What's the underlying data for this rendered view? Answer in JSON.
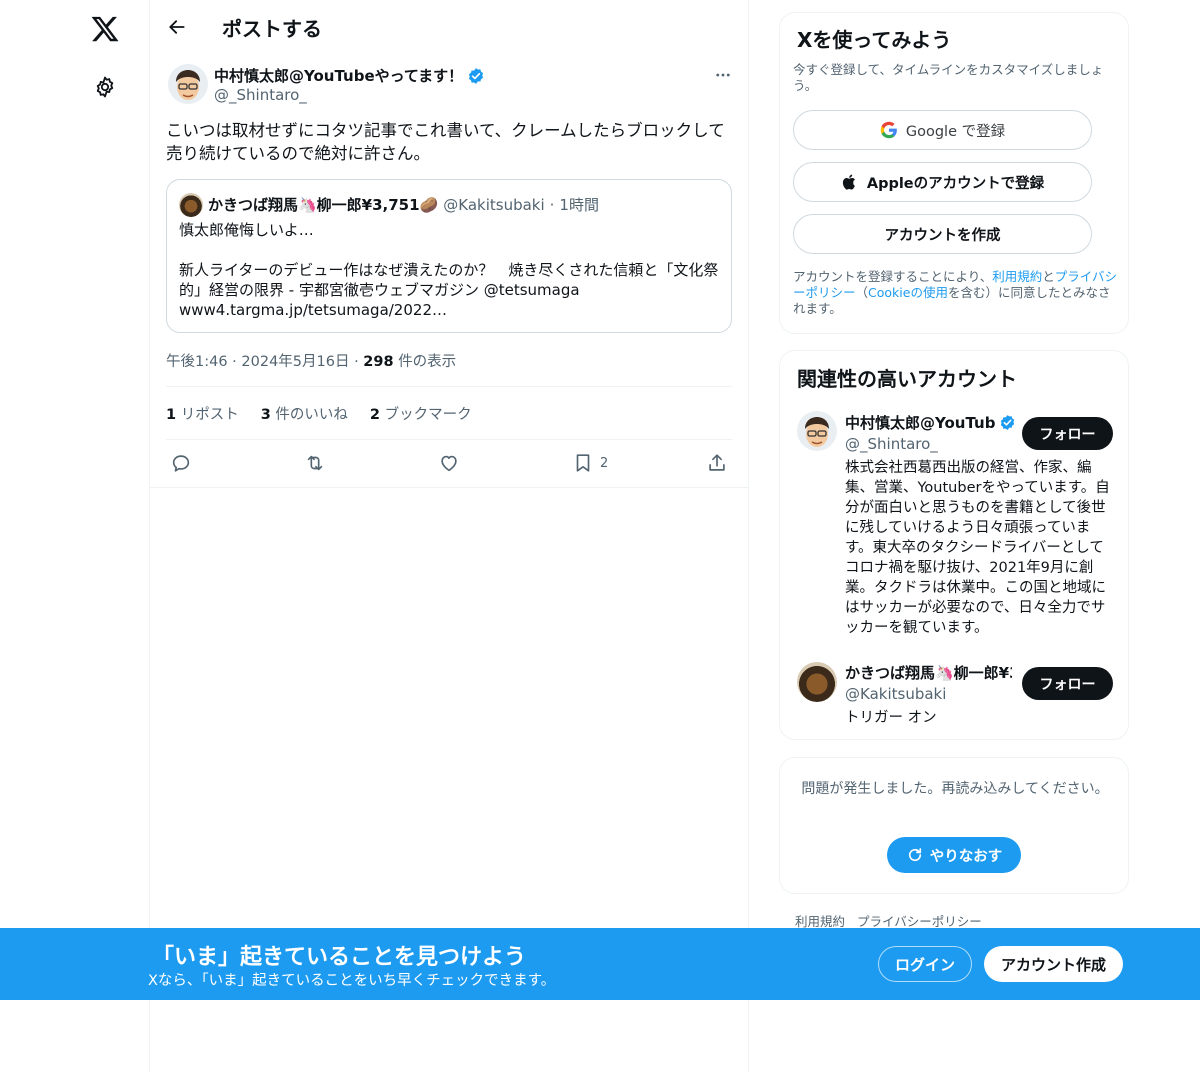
{
  "nav": {
    "logo_icon": "x-logo-icon",
    "settings_icon": "gear-icon"
  },
  "header": {
    "title": "ポストする",
    "back_icon": "arrow-left-icon"
  },
  "tweet": {
    "author_name": "中村慎太郎@YouTubeやってます！",
    "author_handle": "@_Shintaro_",
    "verified": true,
    "text": "こいつは取材せずにコタツ記事でこれ書いて、クレームしたらブロックして売り続けているので絶対に許さん。",
    "quote": {
      "name": "かきつば翔馬🦄柳一郎¥3,751🥔",
      "handle": "@Kakitsubaki",
      "time": "1時間",
      "body": "慎太郎俺悔しいよ…\n\n新人ライターのデビュー作はなぜ潰えたのか？　焼き尽くされた信頼と「文化祭的」経営の限界 - 宇都宮徹壱ウェブマガジン @tetsumaga\nwww4.targma.jp/tetsumaga/2022…"
    },
    "time": "午後1:46",
    "date": "2024年5月16日",
    "views_count": "298",
    "views_label": "件の表示",
    "stats": {
      "reposts_count": "1",
      "reposts_label": "リポスト",
      "likes_count": "3",
      "likes_label": "件のいいね",
      "bookmarks_count": "2",
      "bookmarks_label": "ブックマーク"
    },
    "actions": {
      "bookmark_count": "2"
    }
  },
  "signup": {
    "title": "Xを使ってみよう",
    "subtitle": "今すぐ登録して、タイムラインをカスタマイズしましょう。",
    "google_label": "Google で登録",
    "apple_label": "Appleのアカウントで登録",
    "create_label": "アカウントを作成",
    "terms_1": "アカウントを登録することにより、",
    "terms_link_tos": "利用規約",
    "terms_2": "と",
    "terms_link_privacy": "プライバシーポリシー",
    "terms_3": "（",
    "terms_link_cookie": "Cookieの使用",
    "terms_4": "を含む）に同意したとみなされます。"
  },
  "related": {
    "title": "関連性の高いアカウント",
    "accounts": [
      {
        "name": "中村慎太郎@YouTub",
        "handle": "@_Shintaro_",
        "verified": true,
        "bio": "株式会社西葛西出版の経営、作家、編集、営業、Youtuberをやっています。自分が面白いと思うものを書籍として後世に残していけるよう日々頑張っています。東大卒のタクシードライバーとしてコロナ禍を駆け抜け、2021年9月に創業。タクドラは休業中。この国と地域にはサッカーが必要なので、日々全力でサッカーを観ています。",
        "follow_label": "フォロー"
      },
      {
        "name": "かきつば翔馬🦄柳一郎¥3",
        "handle": "@Kakitsubaki",
        "verified": false,
        "bio": "トリガー オン",
        "follow_label": "フォロー"
      }
    ]
  },
  "error": {
    "message": "問題が発生しました。再読み込みしてください。",
    "retry_label": "やりなおす"
  },
  "footer": {
    "terms": "利用規約",
    "privacy": "プライバシーポリシー"
  },
  "banner": {
    "title": "「いま」起きていることを見つけよう",
    "subtitle": "Xなら、「いま」起きていることをいち早くチェックできます。",
    "login_label": "ログイン",
    "signup_label": "アカウント作成"
  },
  "colors": {
    "accent": "#1d9bf0",
    "text": "#0f1419",
    "muted": "#536471",
    "border": "#eff3f4"
  }
}
